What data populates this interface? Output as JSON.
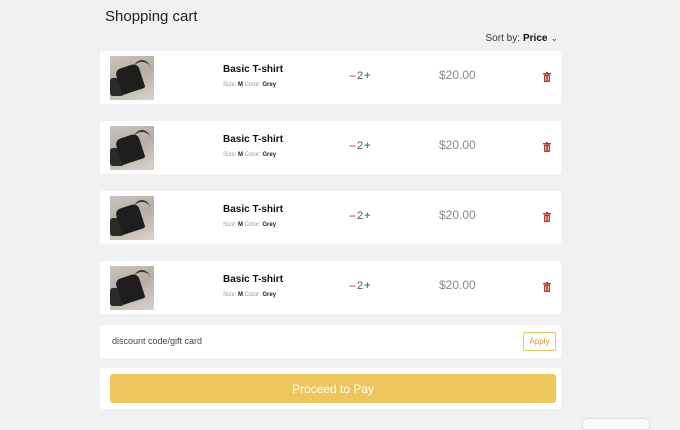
{
  "page": {
    "title": "Shopping cart"
  },
  "sort": {
    "label": "Sort by:",
    "value": "Price"
  },
  "items": [
    {
      "name": "Basic T-shirt",
      "size_label": "Size:",
      "size": "M",
      "color_label": "Color:",
      "color": "Grey",
      "minus": "−",
      "qty": "2",
      "plus": "+",
      "price": "$20.00"
    },
    {
      "name": "Basic T-shirt",
      "size_label": "Size:",
      "size": "M",
      "color_label": "Color:",
      "color": "Grey",
      "minus": "−",
      "qty": "2",
      "plus": "+",
      "price": "$20.00"
    },
    {
      "name": "Basic T-shirt",
      "size_label": "Size:",
      "size": "M",
      "color_label": "Color:",
      "color": "Grey",
      "minus": "−",
      "qty": "2",
      "plus": "+",
      "price": "$20.00"
    },
    {
      "name": "Basic T-shirt",
      "size_label": "Size:",
      "size": "M",
      "color_label": "Color:",
      "color": "Grey",
      "minus": "−",
      "qty": "2",
      "plus": "+",
      "price": "$20.00"
    }
  ],
  "discount": {
    "placeholder": "discount code/gift card",
    "apply_label": "Apply"
  },
  "checkout": {
    "pay_label": "Proceed to Pay"
  },
  "icons": {
    "sort": "chevron-down-icon",
    "remove": "trash-icon",
    "thumbnail": "tshirt-photo"
  },
  "colors": {
    "accent": "#efc65c",
    "decrease": "#c0392b",
    "increase": "#27ae60",
    "remove": "#c0392b"
  }
}
